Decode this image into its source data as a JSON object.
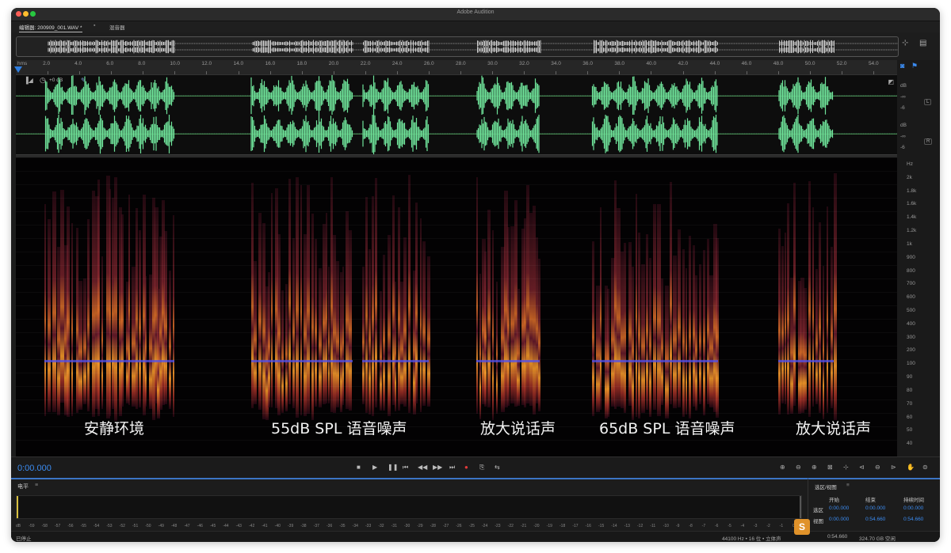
{
  "window": {
    "title": "Adobe Audition"
  },
  "tabs": [
    {
      "label": "编辑器: 200909_001.WAV *"
    },
    {
      "label": "混音器"
    }
  ],
  "ruler": {
    "start_label": "hms",
    "ticks": [
      "2.0",
      "4.0",
      "6.0",
      "8.0",
      "10.0",
      "12.0",
      "14.0",
      "16.0",
      "18.0",
      "20.0",
      "22.0",
      "24.0",
      "26.0",
      "28.0",
      "30.0",
      "32.0",
      "34.0",
      "36.0",
      "38.0",
      "40.0",
      "42.0",
      "44.0",
      "46.0",
      "48.0",
      "50.0",
      "52.0",
      "54.0"
    ]
  },
  "track": {
    "gain": "+0 dB"
  },
  "amplitude_scale": {
    "unit": "dB",
    "top": [
      "dB",
      "-∞",
      "-6",
      "dB",
      "-∞",
      "-6"
    ],
    "channels": [
      "L",
      "R"
    ]
  },
  "frequency_scale": [
    "Hz",
    "2k",
    "1.8k",
    "1.6k",
    "1.4k",
    "1.2k",
    "1k",
    "900",
    "800",
    "700",
    "600",
    "500",
    "400",
    "300",
    "200",
    "100",
    "90",
    "80",
    "70",
    "60",
    "50",
    "40"
  ],
  "captions": [
    "安静环境",
    "55dB SPL 语音噪声",
    "放大说话声",
    "65dB SPL 语音噪声",
    "放大说话声"
  ],
  "transport": {
    "timecode": "0:00.000"
  },
  "levels_panel": {
    "title": "电平",
    "scale": [
      "dB",
      "-59",
      "-58",
      "-57",
      "-56",
      "-55",
      "-54",
      "-53",
      "-52",
      "-51",
      "-50",
      "-49",
      "-48",
      "-47",
      "-46",
      "-45",
      "-44",
      "-43",
      "-42",
      "-41",
      "-40",
      "-39",
      "-38",
      "-37",
      "-36",
      "-35",
      "-34",
      "-33",
      "-32",
      "-31",
      "-30",
      "-29",
      "-28",
      "-27",
      "-26",
      "-25",
      "-24",
      "-23",
      "-22",
      "-21",
      "-20",
      "-19",
      "-18",
      "-17",
      "-16",
      "-15",
      "-14",
      "-13",
      "-12",
      "-11",
      "-10",
      "-9",
      "-8",
      "-7",
      "-6",
      "-5",
      "-4",
      "-3",
      "-2",
      "-1",
      "0"
    ]
  },
  "selection_panel": {
    "title": "选区/视图",
    "headers": [
      "开始",
      "结束",
      "持续时间"
    ],
    "rows": [
      {
        "label": "选区",
        "start": "0:00.000",
        "end": "0:00.000",
        "duration": "0:00.000"
      },
      {
        "label": "视图",
        "start": "0:00.000",
        "end": "0:54.660",
        "duration": "0:54.660"
      }
    ]
  },
  "status": {
    "left": "已停止",
    "format": "44100 Hz • 16 位 • 立体声",
    "duration": "0:54.660",
    "disk": "324.70 GB 空闲"
  },
  "colors": {
    "waveform": "#6fe39a",
    "accent": "#3b8bf0",
    "spectral_hot": "#f0a030"
  }
}
